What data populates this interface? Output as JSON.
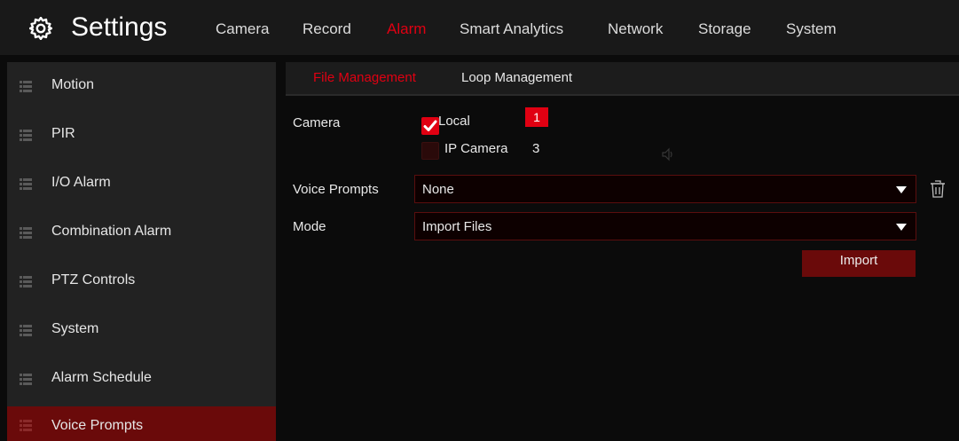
{
  "header": {
    "title": "Settings",
    "icon": "gear-icon",
    "tabs": [
      {
        "label": "Camera",
        "active": false
      },
      {
        "label": "Record",
        "active": false
      },
      {
        "label": "Alarm",
        "active": true
      },
      {
        "label": "Smart Analytics",
        "active": false
      },
      {
        "label": "Network",
        "active": false
      },
      {
        "label": "Storage",
        "active": false
      },
      {
        "label": "System",
        "active": false
      }
    ]
  },
  "sidebar": {
    "icon": "list-icon",
    "items": [
      {
        "label": "Motion",
        "active": false
      },
      {
        "label": "PIR",
        "active": false
      },
      {
        "label": "I/O Alarm",
        "active": false
      },
      {
        "label": "Combination Alarm",
        "active": false
      },
      {
        "label": "PTZ Controls",
        "active": false
      },
      {
        "label": "System",
        "active": false
      },
      {
        "label": "Alarm Schedule",
        "active": false
      },
      {
        "label": "Voice Prompts",
        "active": true
      }
    ]
  },
  "subtabs": [
    {
      "label": "File Management",
      "active": true
    },
    {
      "label": "Loop Management",
      "active": false
    }
  ],
  "form": {
    "camera_label": "Camera",
    "local": {
      "label": "Local",
      "checked": true,
      "count": "1"
    },
    "ip_camera": {
      "label": "IP Camera",
      "checked": false,
      "count": "3"
    },
    "voice_prompts_label": "Voice Prompts",
    "voice_prompts_value": "None",
    "mode_label": "Mode",
    "mode_value": "Import Files",
    "import_button": "Import"
  },
  "colors": {
    "accent": "#e00012",
    "active_bg": "#6a0a0a",
    "sidebar_bg": "#222222",
    "header_bg": "#191919"
  }
}
